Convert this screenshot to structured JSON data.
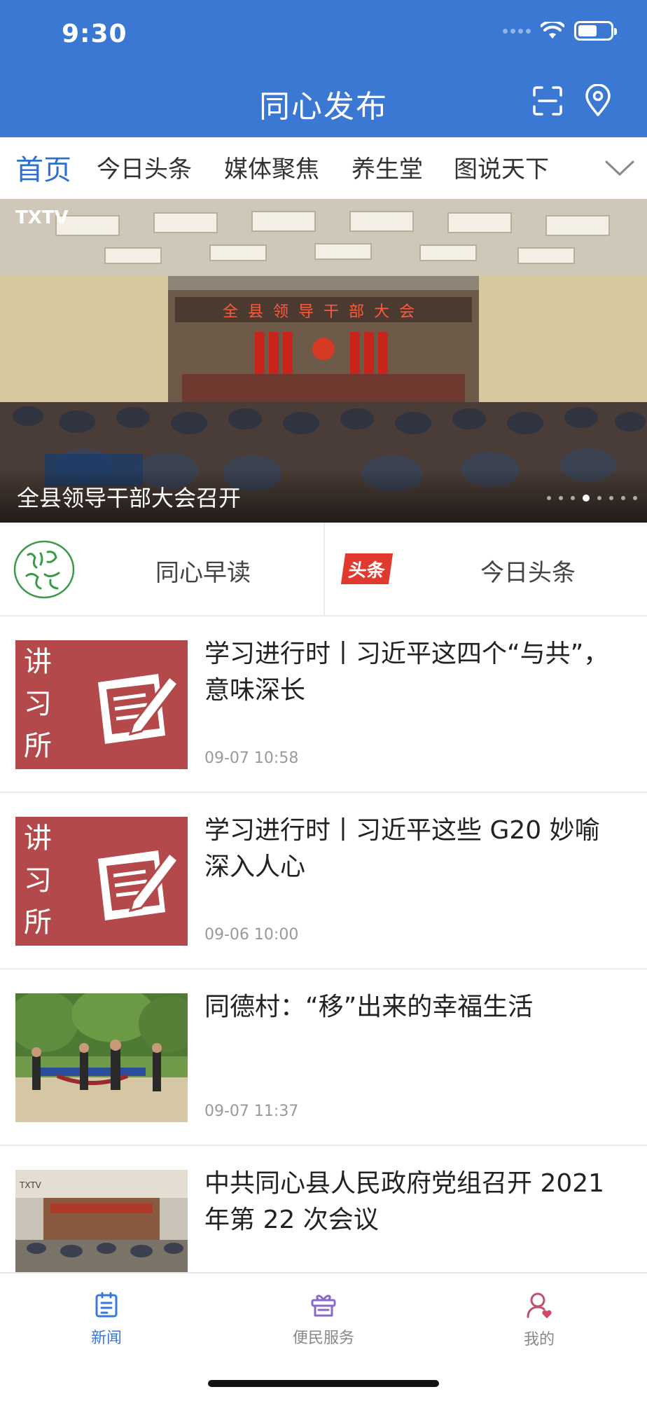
{
  "status_bar": {
    "time": "9:30"
  },
  "header": {
    "title": "同心发布",
    "icons": [
      "scan-icon",
      "location-pin-icon"
    ]
  },
  "channel_tabs": {
    "items": [
      {
        "label": "首页",
        "active": true
      },
      {
        "label": "今日头条",
        "active": false
      },
      {
        "label": "媒体聚焦",
        "active": false
      },
      {
        "label": "养生堂",
        "active": false
      },
      {
        "label": "图说天下",
        "active": false
      }
    ],
    "expand_icon": "chevron-down-icon"
  },
  "banner": {
    "logo_text": "TXTV",
    "caption": "全县领导干部大会召开",
    "stage_text": "全县领导干部大会",
    "dots_total": 8,
    "active_dot": 4
  },
  "shortcuts": [
    {
      "label": "同心早读",
      "icon": "tongxin-morning-read-icon"
    },
    {
      "label": "今日头条",
      "icon_text": "头条"
    }
  ],
  "news": [
    {
      "title": "学习进行时丨习近平这四个“与共”，意味深长",
      "time": "09-07 10:58",
      "thumb_text": [
        "讲",
        "习",
        "所"
      ]
    },
    {
      "title": "学习进行时丨习近平这些 G20 妙喻深入人心",
      "time": "09-06 10:00",
      "thumb_text": [
        "讲",
        "习",
        "所"
      ]
    },
    {
      "title": "同德村：“移”出来的幸福生活",
      "time": "09-07 11:37"
    },
    {
      "title": "中共同心县人民政府党组召开 2021 年第 22 次会议",
      "time": "",
      "thumb_text": [
        "TXTV"
      ]
    }
  ],
  "bottom_tabs": [
    {
      "label": "新闻",
      "icon": "news-icon",
      "active": true
    },
    {
      "label": "便民服务",
      "icon": "gift-icon",
      "active": false
    },
    {
      "label": "我的",
      "icon": "profile-icon",
      "active": false
    }
  ],
  "colors": {
    "brand": "#3a78d4",
    "active_tab": "#2f6fd0",
    "thumb_red": "#b3494a",
    "headline_badge": "#e03a2f"
  }
}
